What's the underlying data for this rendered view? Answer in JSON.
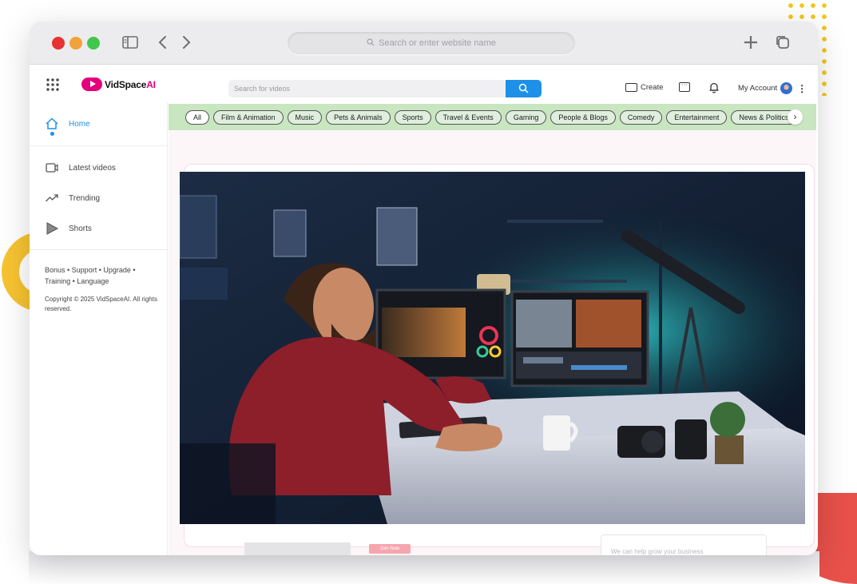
{
  "browser": {
    "address_placeholder": "Search or enter website name"
  },
  "app": {
    "logo": {
      "name": "VidSpace",
      "suffix": "AI"
    },
    "search": {
      "placeholder": "Search for videos"
    },
    "topbar": {
      "create_label": "Create",
      "account_label": "My Account"
    }
  },
  "sidebar": {
    "items": [
      {
        "label": "Home",
        "icon": "home-icon"
      },
      {
        "label": "Latest videos",
        "icon": "video-icon"
      },
      {
        "label": "Trending",
        "icon": "trending-icon"
      },
      {
        "label": "Shorts",
        "icon": "shorts-icon"
      }
    ],
    "footer_links": "Bonus • Support • Upgrade • Training • Language",
    "copyright": "Copyright © 2025 VidSpaceAI. All rights reserved."
  },
  "categories": [
    "All",
    "Film & Animation",
    "Music",
    "Pets & Animals",
    "Sports",
    "Travel & Events",
    "Gaming",
    "People & Blogs",
    "Comedy",
    "Entertainment",
    "News & Politics"
  ],
  "background_content": {
    "join_button": "Join Now",
    "promo_text": "We can help grow your business"
  },
  "colors": {
    "accent": "#1e90e8",
    "brand": "#e4007c",
    "chip_bar": "#c8e6c0"
  }
}
